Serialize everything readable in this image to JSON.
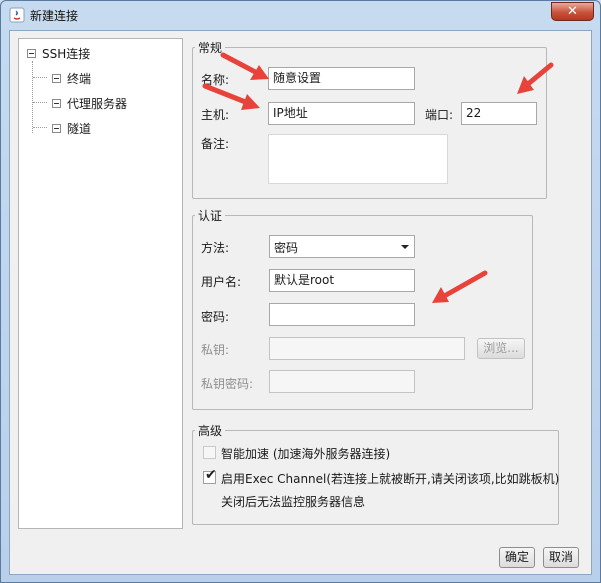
{
  "window": {
    "title": "新建连接",
    "close_glyph": "✕",
    "close_color": "#c8533c"
  },
  "tree": {
    "root": "SSH连接",
    "children": [
      "终端",
      "代理服务器",
      "隧道"
    ]
  },
  "general": {
    "legend": "常规",
    "name_label": "名称:",
    "name_value": "随意设置",
    "host_label": "主机:",
    "host_value": "IP地址",
    "port_label": "端口:",
    "port_value": "22",
    "note_label": "备注:",
    "note_value": ""
  },
  "auth": {
    "legend": "认证",
    "method_label": "方法:",
    "method_value": "密码",
    "user_label": "用户名:",
    "user_value": "默认是root",
    "password_label": "密码:",
    "password_value": "",
    "key_label": "私钥:",
    "key_value": "",
    "browse_label": "浏览...",
    "key_password_label": "私钥密码:",
    "key_password_value": ""
  },
  "advanced": {
    "legend": "高级",
    "smart_accel_label": "智能加速 (加速海外服务器连接)",
    "smart_accel_checked": false,
    "exec_channel_label": "启用Exec Channel(若连接上就被断开,请关闭该项,比如跳板机)",
    "exec_channel_checked": true,
    "exec_channel_note": "关闭后无法监控服务器信息"
  },
  "buttons": {
    "ok": "确定",
    "cancel": "取消"
  },
  "annotation_color": "#e8433a"
}
